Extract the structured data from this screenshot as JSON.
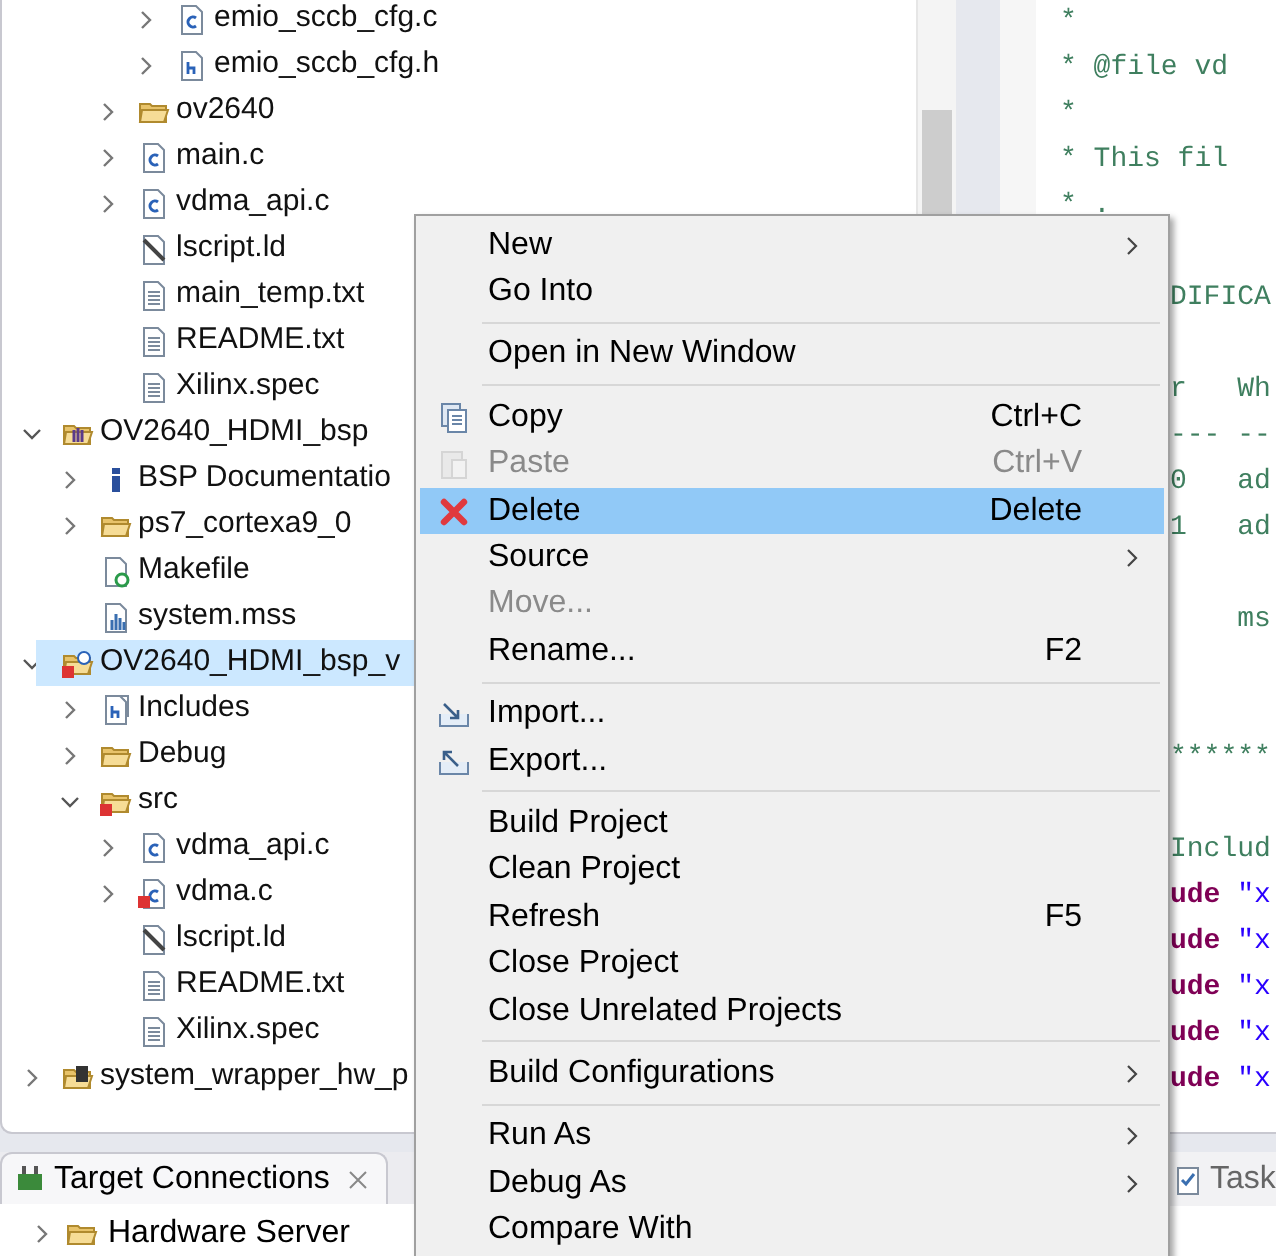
{
  "project_tree": [
    {
      "children": [
        {
          "children": [
            {
              "children": [
                {
                  "label": "emio_sccb_cfg.c",
                  "kind": "c-file",
                  "expandable": true,
                  "expanded": false,
                  "selected": false
                },
                {
                  "label": "emio_sccb_cfg.h",
                  "kind": "h-file",
                  "expandable": true,
                  "expanded": false,
                  "selected": false
                }
              ]
            },
            {
              "label": "ov2640",
              "kind": "folder",
              "expandable": true,
              "expanded": false,
              "selected": false
            },
            {
              "label": "main.c",
              "kind": "c-file",
              "expandable": true,
              "expanded": false,
              "selected": false
            },
            {
              "label": "vdma_api.c",
              "kind": "c-file",
              "expandable": true,
              "expanded": false,
              "selected": false
            },
            {
              "label": "lscript.ld",
              "kind": "linker-file",
              "expandable": false,
              "selected": false
            },
            {
              "label": "main_temp.txt",
              "kind": "text-file",
              "expandable": false,
              "selected": false
            },
            {
              "label": "README.txt",
              "kind": "text-file",
              "expandable": false,
              "selected": false
            },
            {
              "label": "Xilinx.spec",
              "kind": "text-file",
              "expandable": false,
              "selected": false
            }
          ]
        }
      ]
    },
    {
      "label": "OV2640_HDMI_bsp",
      "kind": "bsp-project",
      "expandable": true,
      "expanded": true,
      "selected": false,
      "children": [
        {
          "label": "BSP Documentatio",
          "kind": "info",
          "expandable": true,
          "expanded": false,
          "selected": false
        },
        {
          "label": "ps7_cortexa9_0",
          "kind": "folder",
          "expandable": true,
          "expanded": false,
          "selected": false
        },
        {
          "label": "Makefile",
          "kind": "makefile",
          "expandable": false,
          "selected": false
        },
        {
          "label": "system.mss",
          "kind": "mss-file",
          "expandable": false,
          "selected": false
        }
      ]
    },
    {
      "label": "OV2640_HDMI_bsp_v",
      "kind": "app-project-error",
      "expandable": true,
      "expanded": true,
      "selected": true,
      "children": [
        {
          "label": "Includes",
          "kind": "includes",
          "expandable": true,
          "expanded": false,
          "selected": false
        },
        {
          "label": "Debug",
          "kind": "folder",
          "expandable": true,
          "expanded": false,
          "selected": false
        },
        {
          "label": "src",
          "kind": "folder-error",
          "expandable": true,
          "expanded": true,
          "selected": false,
          "children": [
            {
              "label": "vdma_api.c",
              "kind": "c-file",
              "expandable": true,
              "expanded": false,
              "selected": false
            },
            {
              "label": "vdma.c",
              "kind": "c-file-error",
              "expandable": true,
              "expanded": false,
              "selected": false
            },
            {
              "label": "lscript.ld",
              "kind": "linker-file",
              "expandable": false,
              "selected": false
            },
            {
              "label": "README.txt",
              "kind": "text-file",
              "expandable": false,
              "selected": false
            },
            {
              "label": "Xilinx.spec",
              "kind": "text-file",
              "expandable": false,
              "selected": false
            }
          ]
        }
      ]
    },
    {
      "label": "system_wrapper_hw_p",
      "kind": "hw-project",
      "expandable": true,
      "expanded": false,
      "selected": false
    }
  ],
  "editor_lines": [
    {
      "kind": "full",
      "segments": [
        {
          "text": "*",
          "kind": "comment"
        }
      ]
    },
    {
      "kind": "full",
      "segments": [
        {
          "text": "* @file vd",
          "kind": "comment"
        }
      ]
    },
    {
      "kind": "full",
      "segments": [
        {
          "text": "*",
          "kind": "comment"
        }
      ]
    },
    {
      "kind": "full",
      "segments": [
        {
          "text": "* This fil",
          "kind": "comment"
        }
      ]
    },
    {
      "kind": "full",
      "segments": [
        {
          "text": "* .",
          "kind": "comment"
        }
      ]
    },
    {
      "kind": "blank"
    },
    {
      "kind": "beside-menu",
      "segments": [
        {
          "text": "DIFICA",
          "kind": "comment"
        }
      ]
    },
    {
      "kind": "blank"
    },
    {
      "kind": "beside-menu",
      "segments": [
        {
          "text": "r   Wh",
          "kind": "comment"
        }
      ]
    },
    {
      "kind": "beside-menu",
      "segments": [
        {
          "text": "--- --",
          "kind": "comment"
        }
      ]
    },
    {
      "kind": "beside-menu",
      "segments": [
        {
          "text": "0   ad",
          "kind": "comment"
        }
      ]
    },
    {
      "kind": "beside-menu",
      "segments": [
        {
          "text": "1   ad",
          "kind": "comment"
        }
      ]
    },
    {
      "kind": "blank"
    },
    {
      "kind": "beside-menu",
      "segments": [
        {
          "text": "    ms",
          "kind": "comment"
        }
      ]
    },
    {
      "kind": "blank"
    },
    {
      "kind": "blank"
    },
    {
      "kind": "beside-menu",
      "segments": [
        {
          "text": "******",
          "kind": "comment"
        }
      ]
    },
    {
      "kind": "blank"
    },
    {
      "kind": "beside-menu",
      "segments": [
        {
          "text": "Includ",
          "kind": "comment"
        }
      ]
    },
    {
      "kind": "beside-menu",
      "segments": [
        {
          "text": "ude",
          "kind": "keyword"
        },
        {
          "text": " \"x",
          "kind": "string"
        }
      ]
    },
    {
      "kind": "beside-menu",
      "segments": [
        {
          "text": "ude",
          "kind": "keyword"
        },
        {
          "text": " \"x",
          "kind": "string"
        }
      ]
    },
    {
      "kind": "beside-menu",
      "segments": [
        {
          "text": "ude",
          "kind": "keyword"
        },
        {
          "text": " \"x",
          "kind": "string"
        }
      ]
    },
    {
      "kind": "beside-menu",
      "segments": [
        {
          "text": "ude",
          "kind": "keyword"
        },
        {
          "text": " \"x",
          "kind": "string"
        }
      ]
    },
    {
      "kind": "beside-menu",
      "segments": [
        {
          "text": "ude",
          "kind": "keyword"
        },
        {
          "text": " \"x",
          "kind": "string"
        }
      ]
    }
  ],
  "bottom_left_panel": {
    "tab": {
      "label": "Target Connections",
      "selected": true
    },
    "rows": [
      {
        "label": "Hardware Server",
        "expanded": false
      }
    ]
  },
  "bottom_right_panel": {
    "tab": {
      "label": "Task",
      "selected": false
    }
  },
  "context_menu": [
    {
      "kind": "item",
      "label": "New",
      "submenu": true,
      "disabled": false,
      "selected": false
    },
    {
      "kind": "item",
      "label": "Go Into",
      "submenu": false,
      "disabled": false,
      "selected": false
    },
    {
      "kind": "separator"
    },
    {
      "kind": "item",
      "label": "Open in New Window",
      "submenu": false,
      "disabled": false,
      "selected": false
    },
    {
      "kind": "separator"
    },
    {
      "kind": "copy",
      "label": "Copy",
      "shortcut": "Ctrl+C",
      "submenu": false,
      "disabled": false,
      "selected": false
    },
    {
      "kind": "paste",
      "label": "Paste",
      "shortcut": "Ctrl+V",
      "submenu": false,
      "disabled": true,
      "selected": false
    },
    {
      "kind": "delete",
      "label": "Delete",
      "shortcut": "Delete",
      "submenu": false,
      "disabled": false,
      "selected": true
    },
    {
      "kind": "item",
      "label": "Source",
      "submenu": true,
      "disabled": false,
      "selected": false
    },
    {
      "kind": "item",
      "label": "Move...",
      "submenu": false,
      "disabled": true,
      "selected": false
    },
    {
      "kind": "item",
      "label": "Rename...",
      "shortcut": "F2",
      "submenu": false,
      "disabled": false,
      "selected": false
    },
    {
      "kind": "separator"
    },
    {
      "kind": "import",
      "label": "Import...",
      "submenu": false,
      "disabled": false,
      "selected": false
    },
    {
      "kind": "export",
      "label": "Export...",
      "submenu": false,
      "disabled": false,
      "selected": false
    },
    {
      "kind": "separator"
    },
    {
      "kind": "item",
      "label": "Build Project",
      "submenu": false,
      "disabled": false,
      "selected": false
    },
    {
      "kind": "item",
      "label": "Clean Project",
      "submenu": false,
      "disabled": false,
      "selected": false
    },
    {
      "kind": "item",
      "label": "Refresh",
      "shortcut": "F5",
      "submenu": false,
      "disabled": false,
      "selected": false
    },
    {
      "kind": "item",
      "label": "Close Project",
      "submenu": false,
      "disabled": false,
      "selected": false
    },
    {
      "kind": "item",
      "label": "Close Unrelated Projects",
      "submenu": false,
      "disabled": false,
      "selected": false
    },
    {
      "kind": "separator"
    },
    {
      "kind": "item",
      "label": "Build Configurations",
      "submenu": true,
      "disabled": false,
      "selected": false
    },
    {
      "kind": "separator"
    },
    {
      "kind": "item",
      "label": "Run As",
      "submenu": true,
      "disabled": false,
      "selected": false
    },
    {
      "kind": "item",
      "label": "Debug As",
      "submenu": true,
      "disabled": false,
      "selected": false
    },
    {
      "kind": "item",
      "label": "Compare With",
      "submenu": false,
      "disabled": false,
      "selected": false
    }
  ]
}
